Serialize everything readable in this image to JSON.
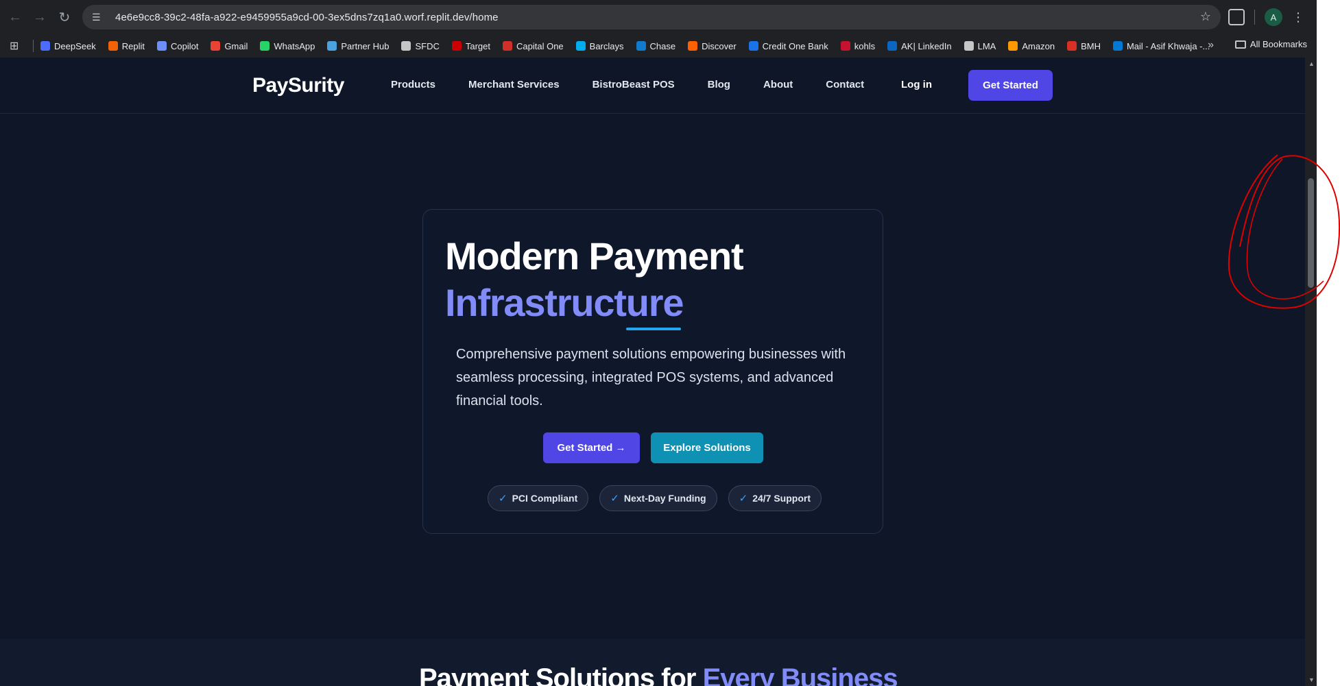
{
  "browser": {
    "url": "4e6e9cc8-39c2-48fa-a922-e9459955a9cd-00-3ex5dns7zq1a0.worf.replit.dev/home",
    "avatar_letter": "A",
    "all_bookmarks_label": "All Bookmarks",
    "bookmarks": [
      {
        "label": "DeepSeek",
        "color": "#4d6bfe"
      },
      {
        "label": "Replit",
        "color": "#f26207"
      },
      {
        "label": "Copilot",
        "color": "#6e8efb"
      },
      {
        "label": "Gmail",
        "color": "#ea4335"
      },
      {
        "label": "WhatsApp",
        "color": "#25d366"
      },
      {
        "label": "Partner Hub",
        "color": "#4aa3df"
      },
      {
        "label": "SFDC",
        "color": "#c4c7c5"
      },
      {
        "label": "Target",
        "color": "#cc0000"
      },
      {
        "label": "Capital One",
        "color": "#d03027"
      },
      {
        "label": "Barclays",
        "color": "#00aeef"
      },
      {
        "label": "Chase",
        "color": "#117aca"
      },
      {
        "label": "Discover",
        "color": "#ff6000"
      },
      {
        "label": "Credit One Bank",
        "color": "#1a73e8"
      },
      {
        "label": "kohls",
        "color": "#c41230"
      },
      {
        "label": "AK| LinkedIn",
        "color": "#0a66c2"
      },
      {
        "label": "LMA",
        "color": "#c4c7c5"
      },
      {
        "label": "Amazon",
        "color": "#ff9900"
      },
      {
        "label": "BMH",
        "color": "#d93025"
      },
      {
        "label": "Mail - Asif Khwaja -...",
        "color": "#0078d4"
      }
    ]
  },
  "site": {
    "logo": "PaySurity",
    "nav": [
      "Products",
      "Merchant Services",
      "BistroBeast POS",
      "Blog",
      "About",
      "Contact"
    ],
    "login_label": "Log in",
    "cta_label": "Get Started"
  },
  "hero": {
    "title_line1": "Modern Payment",
    "title_line2": "Infrastructure",
    "description": "Comprehensive payment solutions empowering businesses with seamless processing, integrated POS systems, and advanced financial tools.",
    "primary_button": "Get Started →",
    "secondary_button": "Explore Solutions",
    "badges": [
      "PCI Compliant",
      "Next-Day Funding",
      "24/7 Support"
    ]
  },
  "section2": {
    "title_part1": "Payment Solutions for ",
    "title_part2": "Every Business"
  },
  "colors": {
    "page_bg": "#0e1628",
    "accent": "#4f46e5",
    "accent_text": "#818cf8",
    "teal": "#0e91b3",
    "annotation": "#e00000"
  }
}
